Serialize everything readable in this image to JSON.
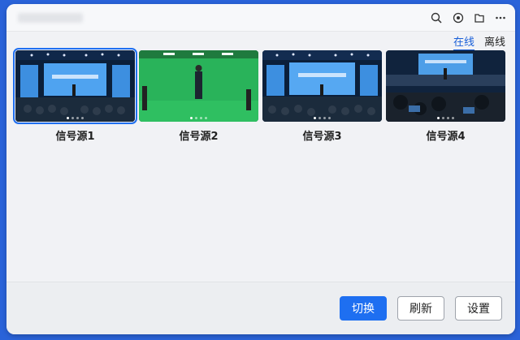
{
  "toolbar": {
    "icons": [
      "search-icon",
      "target-icon",
      "folder-icon",
      "more-icon"
    ]
  },
  "tabs": [
    {
      "label": "在线",
      "active": true
    },
    {
      "label": "离线",
      "active": false
    }
  ],
  "sources": [
    {
      "label": "信号源1",
      "scene": "stage",
      "selected": true
    },
    {
      "label": "信号源2",
      "scene": "greenscreen",
      "selected": false
    },
    {
      "label": "信号源3",
      "scene": "stage",
      "selected": false
    },
    {
      "label": "信号源4",
      "scene": "stage-audience",
      "selected": false
    }
  ],
  "footer": {
    "switch_label": "切换",
    "refresh_label": "刷新",
    "settings_label": "设置"
  },
  "colors": {
    "accent": "#1e6ff1",
    "background": "#2a63d9"
  }
}
